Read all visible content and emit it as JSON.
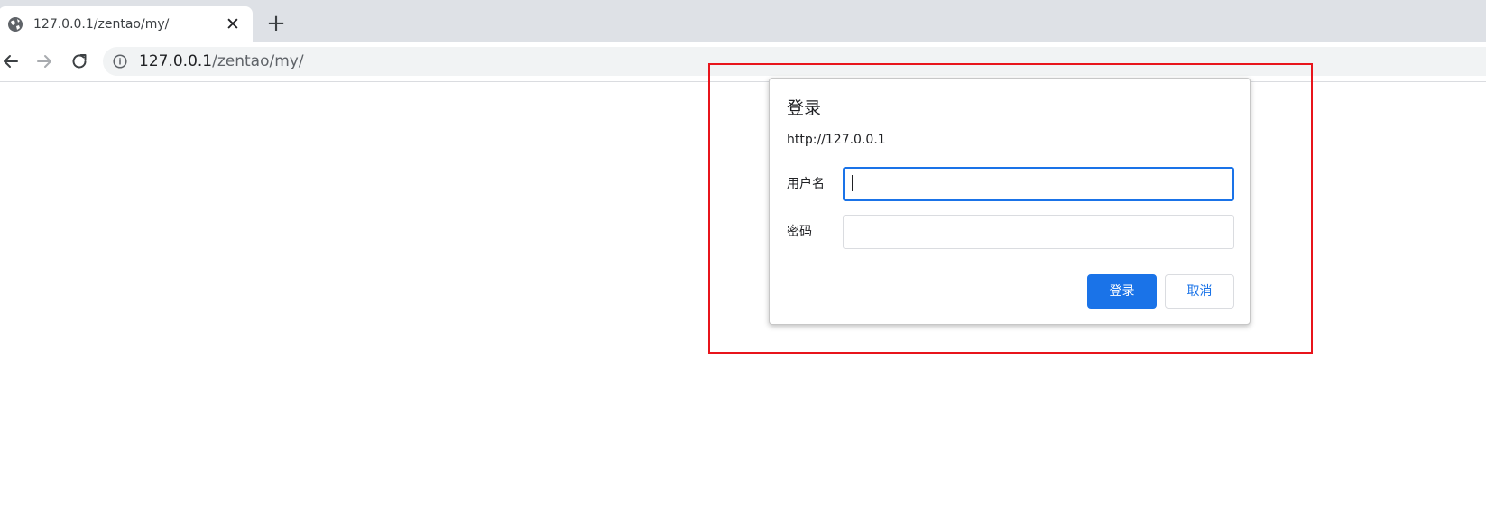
{
  "tab": {
    "title": "127.0.0.1/zentao/my/",
    "close_glyph": "✕",
    "favicon": "globe-icon"
  },
  "new_tab_glyph": "+",
  "toolbar": {
    "back_icon": "back-arrow-icon",
    "forward_icon": "forward-arrow-icon",
    "reload_icon": "reload-icon"
  },
  "address_bar": {
    "icon": "info-icon",
    "host": "127.0.0.1",
    "path": "/zentao/my/"
  },
  "dialog": {
    "title": "登录",
    "origin": "http://127.0.0.1",
    "username_label": "用户名",
    "username_value": "",
    "password_label": "密码",
    "password_value": "",
    "login_label": "登录",
    "cancel_label": "取消"
  },
  "colors": {
    "accent": "#1a73e8",
    "highlight_border": "#e8141b",
    "tabstrip": "#dee1e6"
  }
}
